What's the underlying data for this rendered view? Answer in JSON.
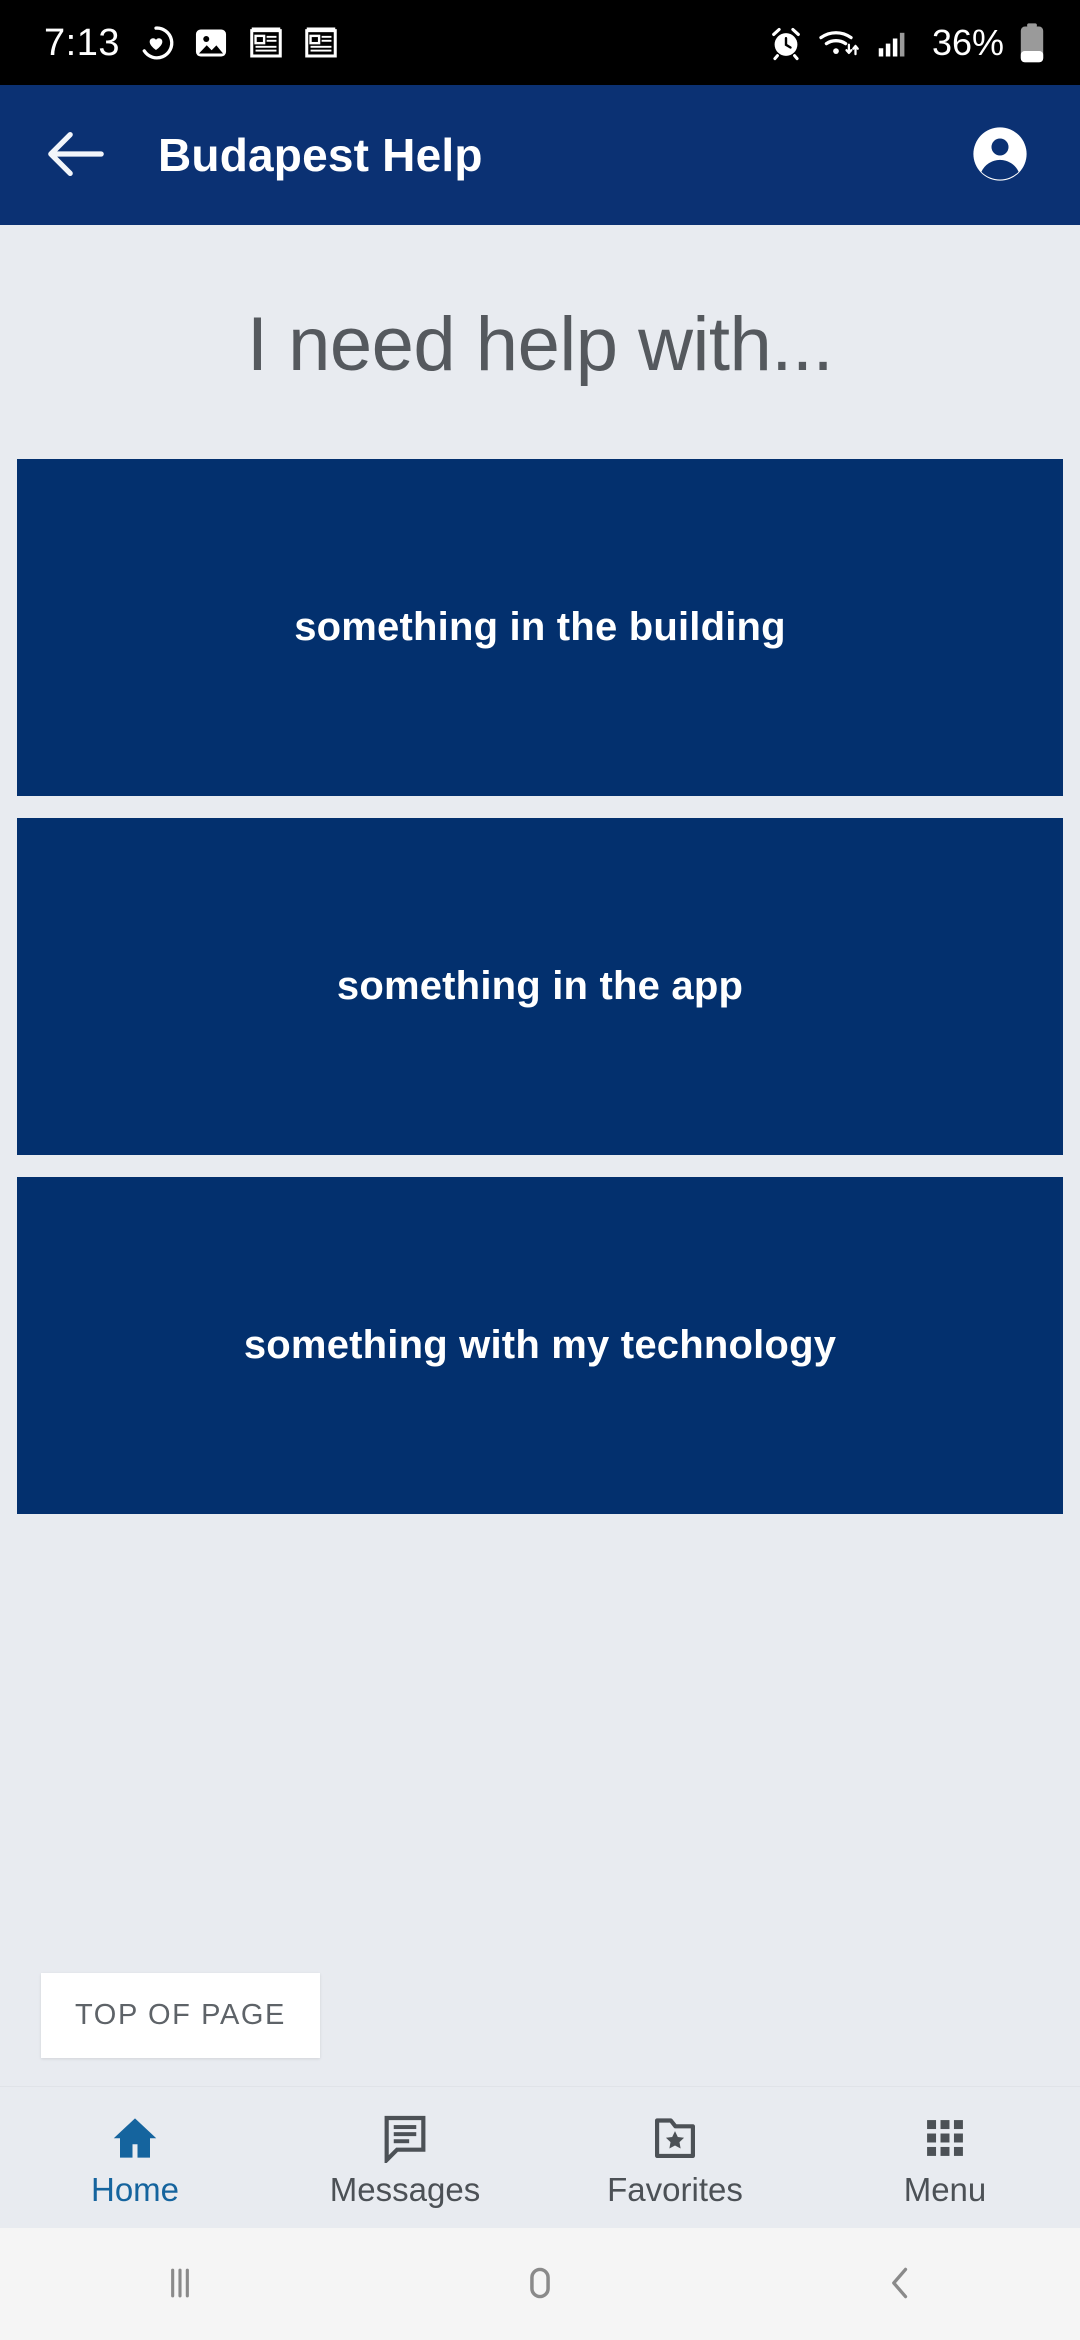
{
  "status_bar": {
    "time": "7:13",
    "battery_percent": "36%",
    "left_icons": [
      "health-heart-icon",
      "gallery-image-icon",
      "news-article-icon",
      "news-article-icon"
    ],
    "right_icons": [
      "alarm-clock-icon",
      "wifi-icon",
      "cellular-signal-icon",
      "battery-icon"
    ],
    "background_color": "#000000",
    "foreground_color": "#FFFFFF"
  },
  "header": {
    "title": "Budapest Help",
    "back_icon": "arrow-left-icon",
    "account_icon": "account-circle-icon",
    "background_color": "#0B3173",
    "text_color": "#FFFFFF"
  },
  "main": {
    "heading": "I need help with...",
    "heading_color": "#55595E",
    "background_color": "#E8EBF0",
    "cards": [
      {
        "label": "something in the building"
      },
      {
        "label": "something in the app"
      },
      {
        "label": "something with my technology"
      }
    ],
    "card_color": "#03306E",
    "card_text_color": "#FFFFFF",
    "top_of_page_button": "TOP OF PAGE"
  },
  "bottom_nav": {
    "active_color": "#15649E",
    "inactive_color": "#4C5156",
    "items": [
      {
        "label": "Home",
        "icon": "home-icon",
        "active": true
      },
      {
        "label": "Messages",
        "icon": "message-icon",
        "active": false
      },
      {
        "label": "Favorites",
        "icon": "folder-star-icon",
        "active": false
      },
      {
        "label": "Menu",
        "icon": "grid-menu-icon",
        "active": false
      }
    ]
  },
  "system_nav": {
    "recents_icon": "recents-icon",
    "home_icon": "home-circle-icon",
    "back_icon": "back-chevron-icon"
  }
}
